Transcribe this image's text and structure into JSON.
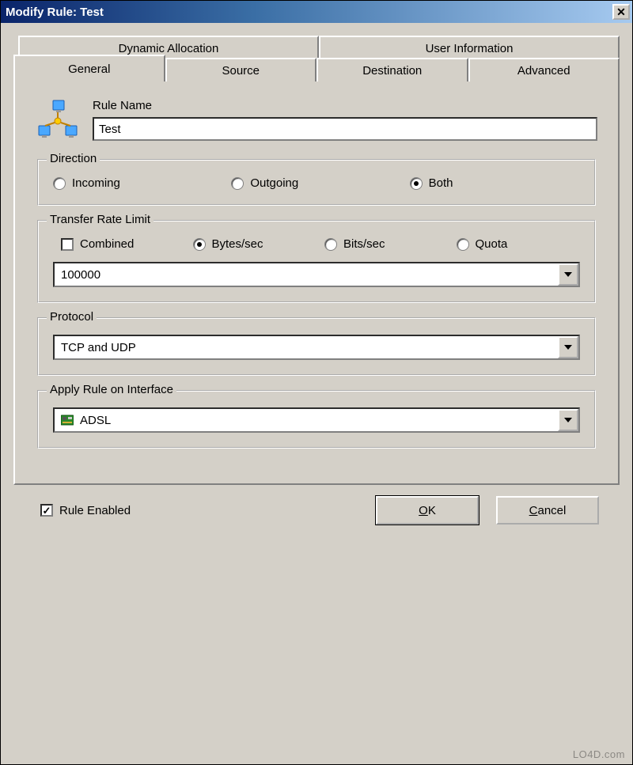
{
  "title": "Modify Rule: Test",
  "tabs": {
    "back": [
      "Dynamic Allocation",
      "User Information"
    ],
    "front": [
      "General",
      "Source",
      "Destination",
      "Advanced"
    ],
    "active": "General"
  },
  "rule": {
    "name_label": "Rule Name",
    "name_value": "Test"
  },
  "direction": {
    "group_label": "Direction",
    "options": [
      "Incoming",
      "Outgoing",
      "Both"
    ],
    "selected": "Both"
  },
  "rate": {
    "group_label": "Transfer Rate Limit",
    "combined_label": "Combined",
    "combined_checked": false,
    "unit_options": [
      "Bytes/sec",
      "Bits/sec",
      "Quota"
    ],
    "unit_selected": "Bytes/sec",
    "value": "100000"
  },
  "protocol": {
    "group_label": "Protocol",
    "value": "TCP and UDP"
  },
  "interface": {
    "group_label": "Apply Rule on Interface",
    "value": "ADSL"
  },
  "rule_enabled": {
    "label": "Rule Enabled",
    "checked": true
  },
  "buttons": {
    "ok": "OK",
    "cancel": "Cancel"
  },
  "watermark": "LO4D.com"
}
